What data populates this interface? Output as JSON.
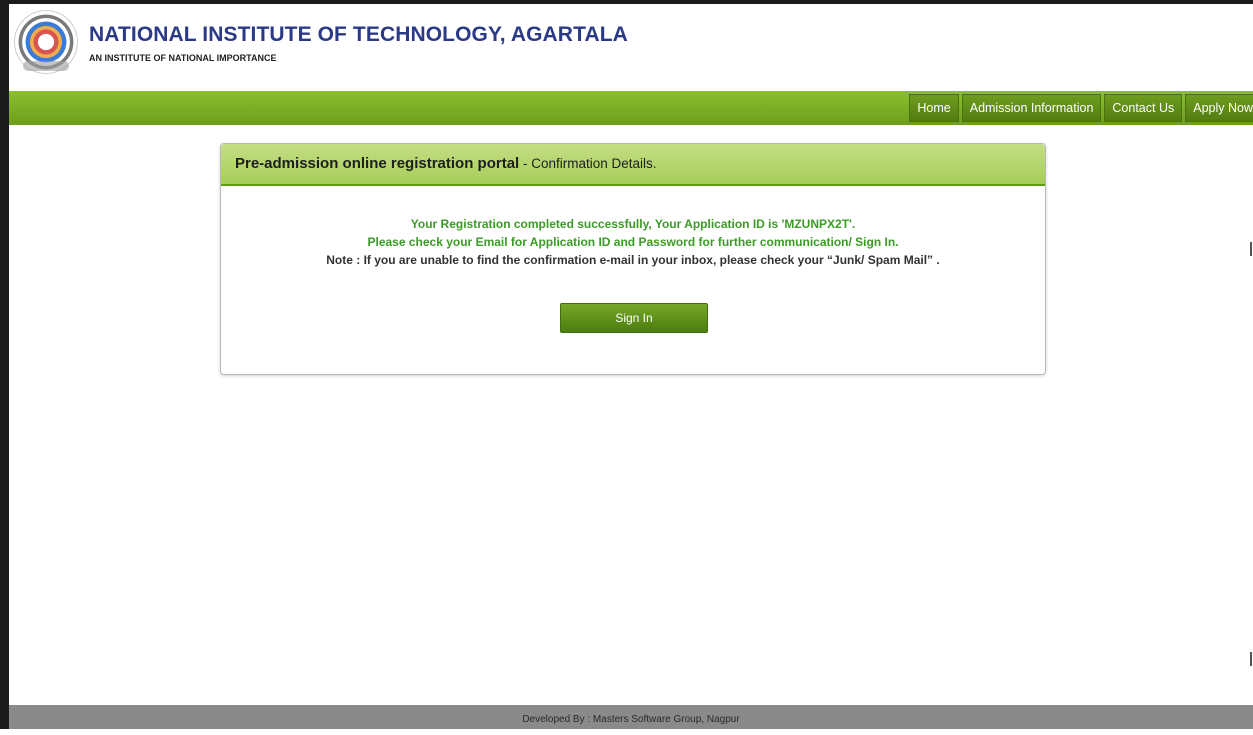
{
  "header": {
    "institute_name": "NATIONAL INSTITUTE OF TECHNOLOGY, AGARTALA",
    "tagline": "AN INSTITUTE OF NATIONAL IMPORTANCE",
    "logo_icon": "institute-seal-icon"
  },
  "nav": {
    "items": [
      {
        "label": "Home"
      },
      {
        "label": "Admission Information"
      },
      {
        "label": "Contact Us"
      },
      {
        "label": "Apply Now"
      }
    ]
  },
  "panel": {
    "title_strong": "Pre-admission online registration portal",
    "title_rest": " - Confirmation Details.",
    "message_line1": "Your Registration completed successfully, Your Application ID is 'MZUNPX2T'.",
    "message_line2": "Please check your Email for Application ID and Password for further communication/ Sign In.",
    "message_line3": "Note : If you are unable to find the confirmation e-mail in your inbox, please check your “Junk/ Spam Mail” .",
    "signin_label": "Sign In"
  },
  "footer": {
    "text": "Developed By : Masters Software Group, Nagpur"
  },
  "colors": {
    "nav_green": "#7aae25",
    "title_blue": "#2b3a87",
    "success_green": "#3c9b26"
  }
}
